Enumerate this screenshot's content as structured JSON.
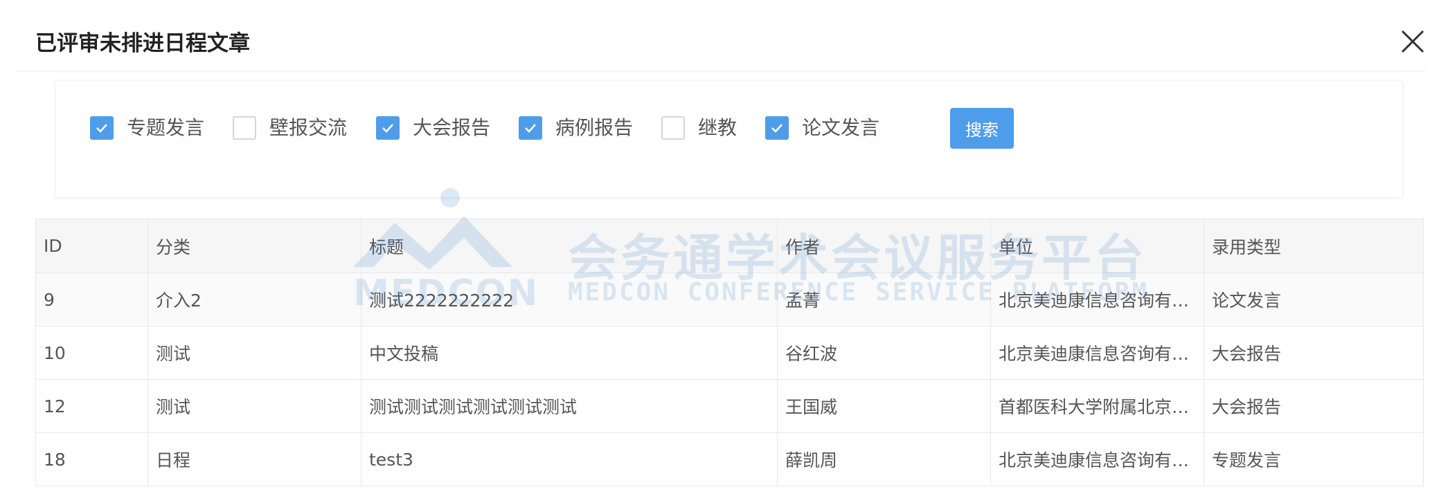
{
  "dialog": {
    "title": "已评审未排进日程文章"
  },
  "filters": [
    {
      "label": "专题发言",
      "checked": true
    },
    {
      "label": "壁报交流",
      "checked": false
    },
    {
      "label": "大会报告",
      "checked": true
    },
    {
      "label": "病例报告",
      "checked": true
    },
    {
      "label": "继教",
      "checked": false
    },
    {
      "label": "论文发言",
      "checked": true
    }
  ],
  "search_label": "搜索",
  "table": {
    "headers": [
      "ID",
      "分类",
      "标题",
      "作者",
      "单位",
      "录用类型"
    ],
    "rows": [
      [
        "9",
        "介入2",
        "测试2222222222",
        "孟菁",
        "北京美迪康信息咨询有限公司",
        "论文发言"
      ],
      [
        "10",
        "测试",
        "中文投稿",
        "谷红波",
        "北京美迪康信息咨询有限公司",
        "大会报告"
      ],
      [
        "12",
        "测试",
        "测试测试测试测试测试测试",
        "王国威",
        "首都医科大学附属北京安贞医院",
        "大会报告"
      ],
      [
        "18",
        "日程",
        "test3",
        "薛凯周",
        "北京美迪康信息咨询有限公司",
        "专题发言"
      ]
    ]
  },
  "watermark": {
    "title_cn": "会务通学术会议服务平台",
    "title_en": "MEDCON CONFERENCE SERVICE PLATFORM",
    "logo_text": "MEDCON"
  },
  "colors": {
    "accent": "#4e9dea",
    "border": "#e8e8e8",
    "header_bg": "#f6f6f6"
  }
}
